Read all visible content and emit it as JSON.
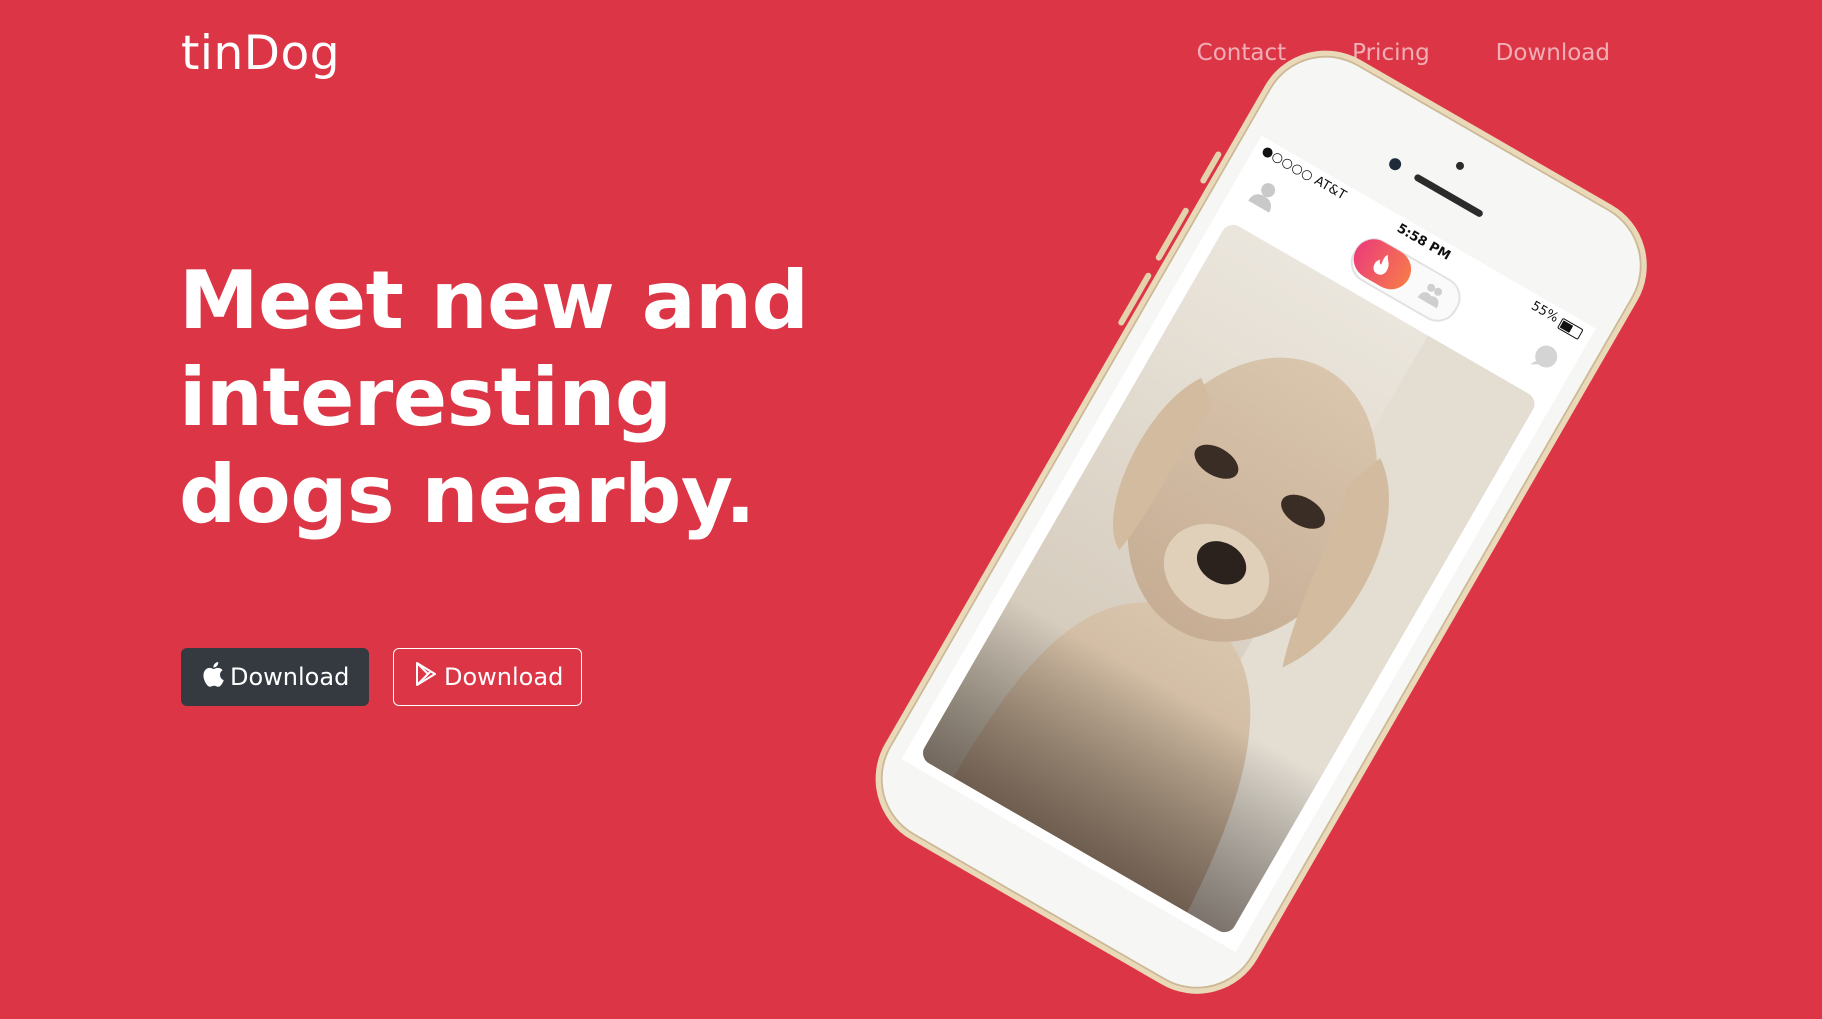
{
  "brand": {
    "name": "tinDog"
  },
  "nav": {
    "items": [
      "Contact",
      "Pricing",
      "Download"
    ]
  },
  "hero": {
    "headline": "Meet new and interesting dogs nearby.",
    "buttons": [
      {
        "label": "Download",
        "icon": "apple-icon"
      },
      {
        "label": "Download",
        "icon": "google-play-icon"
      }
    ]
  },
  "phone": {
    "status": {
      "carrier": "●○○○○ AT&T",
      "time": "5:58 PM",
      "battery": "55%"
    }
  },
  "colors": {
    "background": "#dc3546",
    "dark_button": "#343a40",
    "text": "#ffffff"
  }
}
